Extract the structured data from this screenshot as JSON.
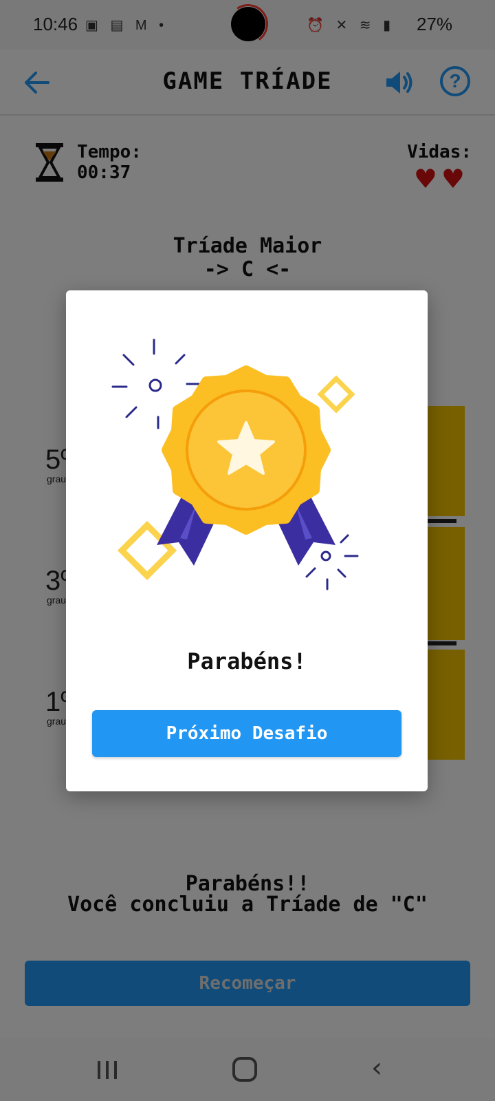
{
  "status_bar": {
    "time": "10:46",
    "battery": "27%",
    "left_icons": [
      "image-icon",
      "cast-icon",
      "gmail-icon",
      "dot-icon"
    ],
    "right_icons": [
      "alarm-icon",
      "mute-icon",
      "wifi-icon",
      "volte-icon",
      "signal-icon",
      "battery-icon"
    ]
  },
  "header": {
    "title": "GAME TRÍADE",
    "help_symbol": "?"
  },
  "game": {
    "time_label": "Tempo:",
    "time_value": "00:37",
    "lives_label": "Vidas:",
    "hearts": "♥♥",
    "lives": 2,
    "triad_title": "Tríade Maior",
    "triad_note": "-> C <-",
    "degrees": [
      {
        "num": "5º",
        "unit": "grau"
      },
      {
        "num": "3º",
        "unit": "grau"
      },
      {
        "num": "1º",
        "unit": "grau"
      }
    ],
    "congrats_line1": "Parabéns!!",
    "congrats_line2": "Você concluiu a Tríade de \"C\"",
    "restart_label": "Recomeçar"
  },
  "modal": {
    "title": "Parabéns!",
    "button_label": "Próximo Desafio",
    "illustration": "medal-star-icon"
  },
  "colors": {
    "accent": "#2196f3",
    "heart": "#d01010",
    "card": "#f0c000",
    "medal_gold": "#fbbf24",
    "ribbon": "#3b2ea0"
  }
}
